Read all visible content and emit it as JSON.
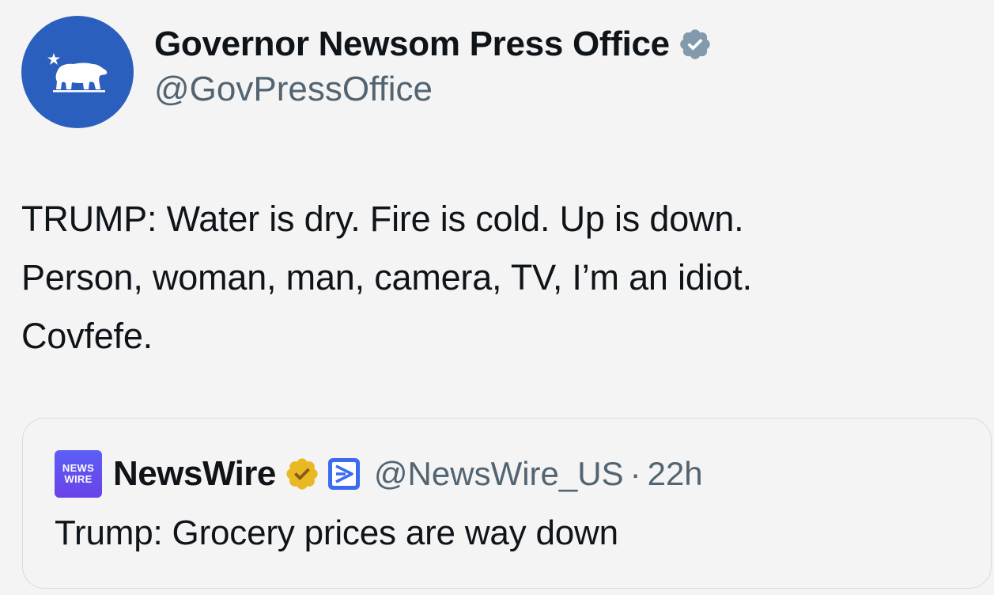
{
  "author": {
    "display_name": "Governor Newsom Press Office",
    "handle": "@GovPressOffice",
    "avatar_icon": "california-bear-star-icon",
    "avatar_color": "#2b5fbd",
    "verified_badge_color": "#829aab"
  },
  "tweet": {
    "lines": [
      "TRUMP: Water is dry. Fire is cold. Up is down.",
      "Person, woman, man, camera, TV, I’m an idiot.",
      "Covfefe."
    ]
  },
  "quoted_tweet": {
    "avatar_text_1": "NEWS",
    "avatar_text_2": "WIRE",
    "display_name": "NewsWire",
    "verified_badge_color": "#e8b923",
    "affiliate_badge_color": "#3b6cf0",
    "handle": "@NewsWire_US",
    "separator": "·",
    "time": "22h",
    "text": "Trump: Grocery prices are way down"
  }
}
